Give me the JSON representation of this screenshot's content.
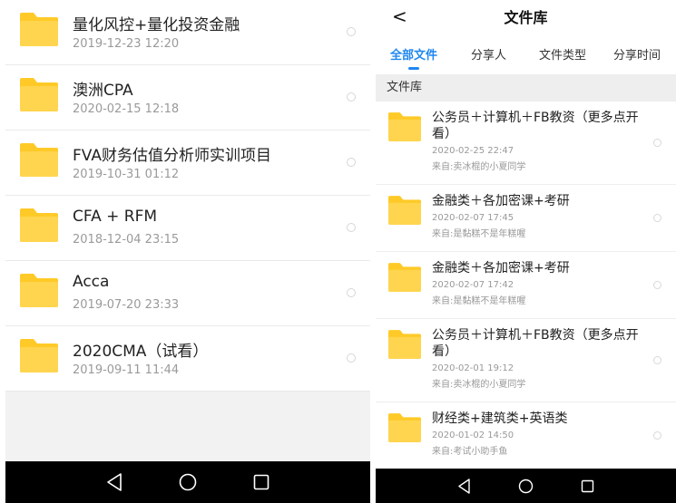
{
  "left_screen": {
    "items": [
      {
        "name": "量化风控+量化投资金融",
        "date": "2019-12-23  12:20"
      },
      {
        "name": "澳洲CPA",
        "date": "2020-02-15  12:18"
      },
      {
        "name": "FVA财务估值分析师实训项目",
        "date": "2019-10-31  01:12"
      },
      {
        "name": "CFA + RFM",
        "date": "2018-12-04  23:15"
      },
      {
        "name": "Acca",
        "date": "2019-07-20  23:33"
      },
      {
        "name": "2020CMA（试看）",
        "date": "2019-09-11  11:44"
      }
    ]
  },
  "right_screen": {
    "back_glyph": "<",
    "title": "文件库",
    "tabs": [
      {
        "label": "全部文件",
        "active": true
      },
      {
        "label": "分享人",
        "active": false
      },
      {
        "label": "文件类型",
        "active": false
      },
      {
        "label": "分享时间",
        "active": false
      }
    ],
    "section_label": "文件库",
    "items": [
      {
        "name": "公务员＋计算机＋FB教资（更多点开看）",
        "date": "2020-02-25  22:47",
        "source": "来自:卖冰棍的小夏同学"
      },
      {
        "name": "金融类＋各加密课+考研",
        "date": "2020-02-07  17:45",
        "source": "来自:是黏糕不是年糕喔"
      },
      {
        "name": "金融类＋各加密课+考研",
        "date": "2020-02-07  17:42",
        "source": "来自:是黏糕不是年糕喔"
      },
      {
        "name": "公务员＋计算机＋FB教资（更多点开看）",
        "date": "2020-02-01  19:12",
        "source": "来自:卖冰棍的小夏同学"
      },
      {
        "name": "财经类+建筑类+英语类",
        "date": "2020-01-02  14:50",
        "source": "来自:考试小助手鱼"
      }
    ]
  },
  "colors": {
    "folder": "#FFCA28",
    "accent": "#1E87F0",
    "nav_bar": "#000000"
  },
  "icons": {
    "folder": "folder-icon",
    "nav_back": "nav-back-icon",
    "nav_home": "nav-home-icon",
    "nav_recents": "nav-recents-icon"
  }
}
